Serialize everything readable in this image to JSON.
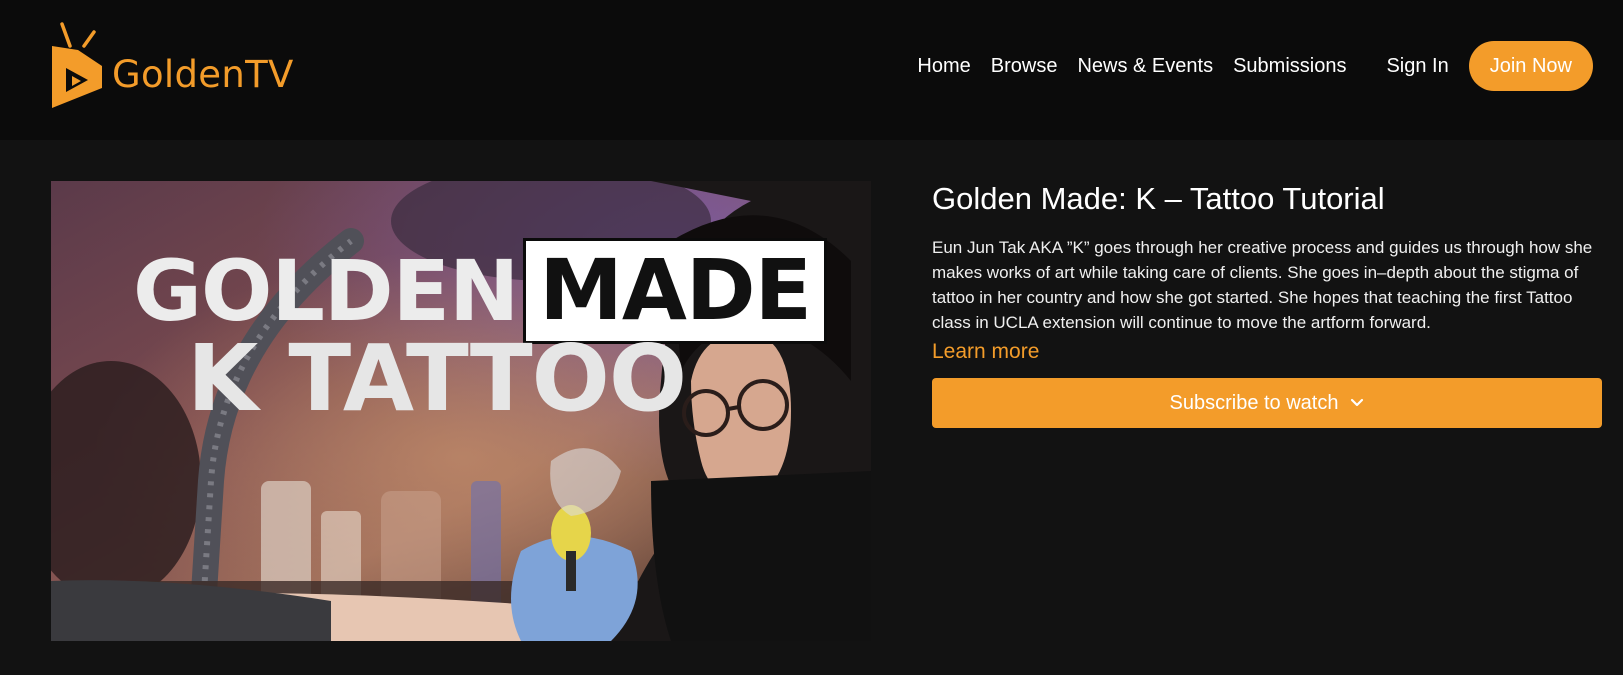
{
  "colors": {
    "accent": "#f39c2a",
    "background": "#121212",
    "header_bg": "#0b0b0b",
    "text": "#ffffff"
  },
  "header": {
    "logo_text": "GoldenTV",
    "logo_icon": "tv-play-icon",
    "nav": [
      {
        "label": "Home"
      },
      {
        "label": "Browse"
      },
      {
        "label": "News & Events"
      },
      {
        "label": "Submissions"
      }
    ],
    "sign_in": "Sign In",
    "join_now": "Join Now"
  },
  "hero": {
    "thumbnail": {
      "word_golden": "GOLDEN",
      "word_made": "MADE",
      "subtitle": "K TATTOO"
    },
    "title": "Golden Made: K – Tattoo Tutorial",
    "description": "Eun Jun Tak AKA ”K” goes through her creative process and guides us through how she makes works of art while taking care of clients. She goes in–depth about the stigma of tattoo in her country and how she got started. She hopes that teaching the first Tattoo class in UCLA extension will continue to move the artform forward.",
    "learn_more": "Learn more",
    "subscribe": "Subscribe to watch",
    "subscribe_icon": "chevron-down-icon"
  }
}
